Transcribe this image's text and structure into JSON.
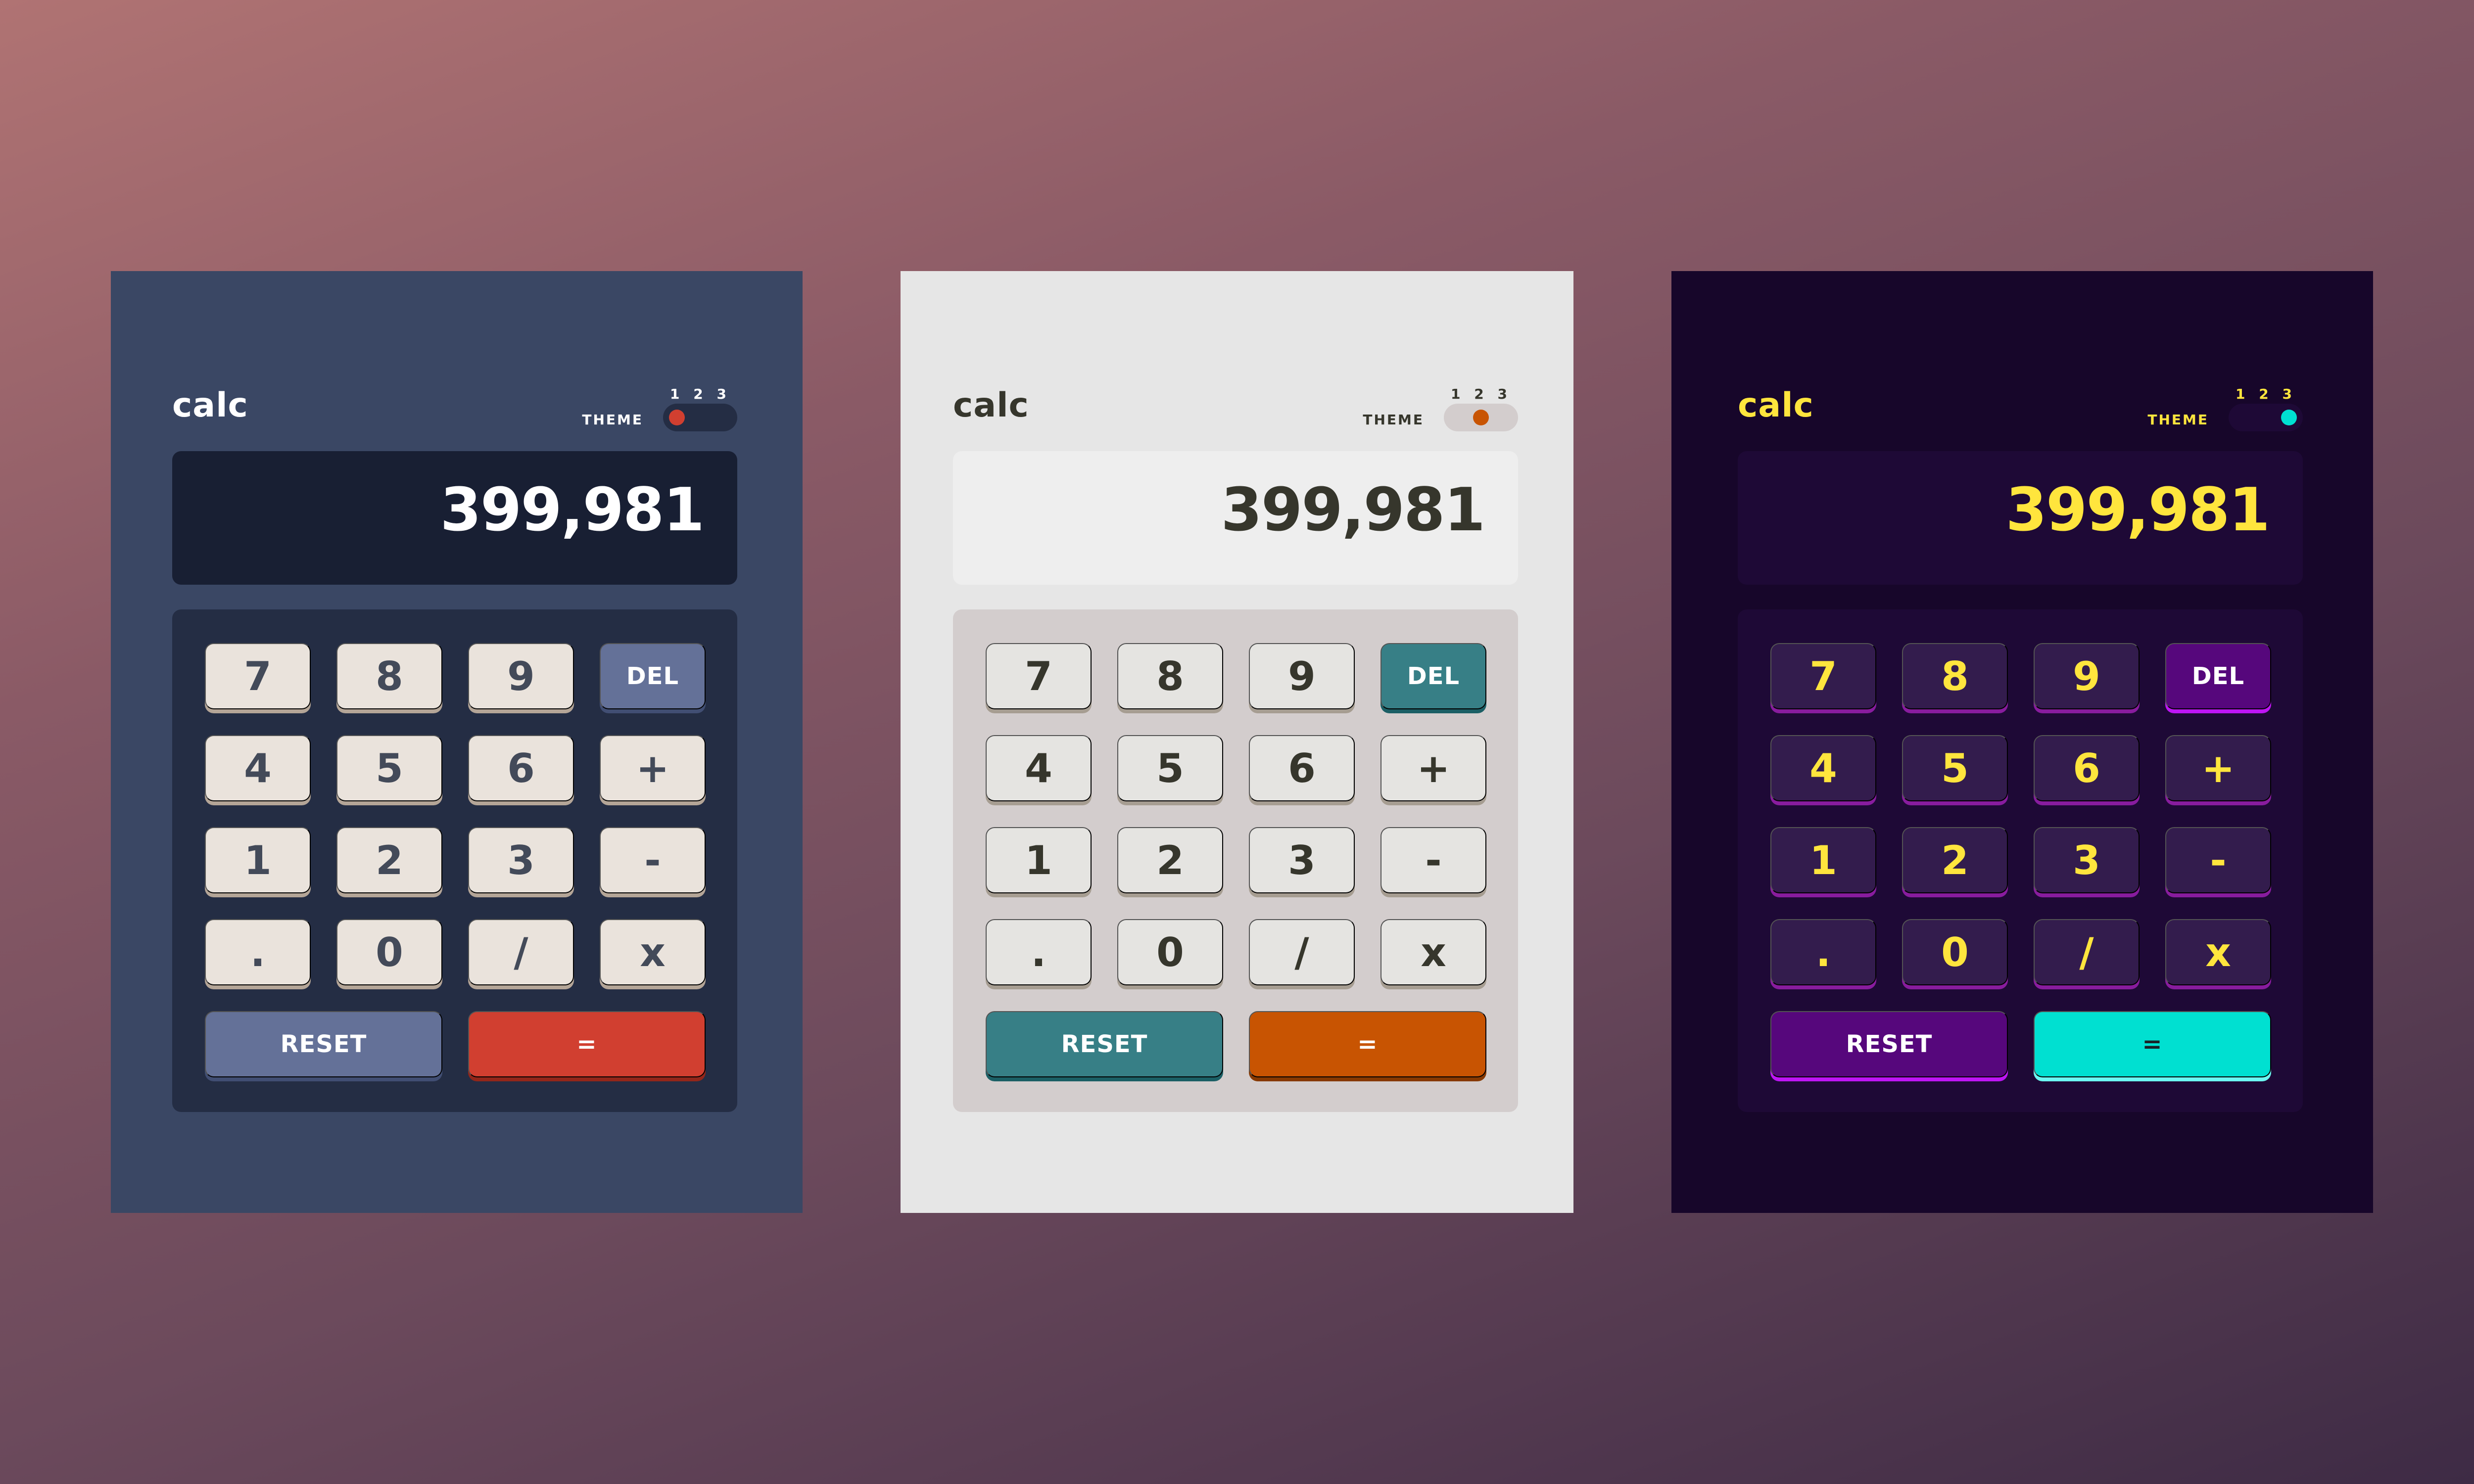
{
  "themes": [
    {
      "brand": "calc",
      "theme_label": "THEME",
      "theme_numbers": [
        "1",
        "2",
        "3"
      ],
      "active_theme": "1",
      "display": "399,981",
      "colors": {
        "background": "#3a4764",
        "accent": "#d13f30"
      }
    },
    {
      "brand": "calc",
      "theme_label": "THEME",
      "theme_numbers": [
        "1",
        "2",
        "3"
      ],
      "active_theme": "2",
      "display": "399,981",
      "colors": {
        "background": "#e6e6e6",
        "accent": "#c85402"
      }
    },
    {
      "brand": "calc",
      "theme_label": "THEME",
      "theme_numbers": [
        "1",
        "2",
        "3"
      ],
      "active_theme": "3",
      "display": "399,981",
      "colors": {
        "background": "#17062a",
        "accent": "#00e0d1"
      }
    }
  ],
  "keys": {
    "k7": "7",
    "k8": "8",
    "k9": "9",
    "del": "DEL",
    "k4": "4",
    "k5": "5",
    "k6": "6",
    "plus": "+",
    "k1": "1",
    "k2": "2",
    "k3": "3",
    "minus": "-",
    "dot": ".",
    "k0": "0",
    "divide": "/",
    "multiply": "x",
    "reset": "RESET",
    "equals": "="
  }
}
